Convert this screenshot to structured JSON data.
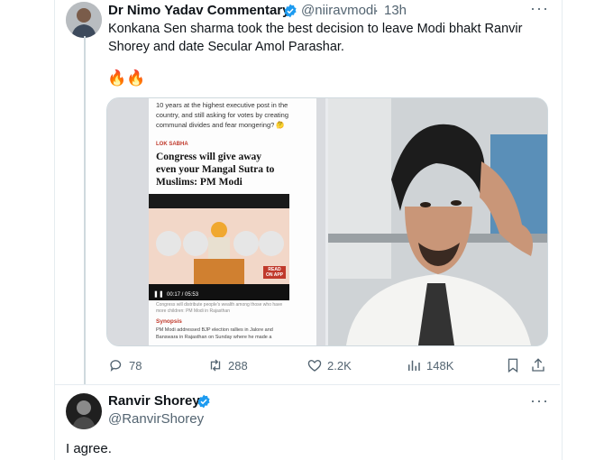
{
  "tweet": {
    "author_name": "Dr Nimo Yadav Commentary",
    "handle": "@niiravmodi",
    "separator": "·",
    "time": "13h",
    "text_line1": "Konkana Sen sharma took the best decision to leave Modi bhakt Ranvir",
    "text_line2": "Shorey and date Secular Amol Parashar.",
    "emoji": "🔥🔥",
    "media_left": {
      "top_text_1": "10 years at the highest executive post in the",
      "top_text_2": "country, and still asking for votes by creating",
      "top_text_3": "communal divides and fear mongering? 🤔",
      "section": "LOK SABHA",
      "headline_1": "Congress will give away",
      "headline_2": "even your Mangal Sutra to",
      "headline_3": "Muslims: PM Modi",
      "video_time": "00:17 / 05:53",
      "badge_1": "READ",
      "badge_2": "ON APP",
      "caption": "Congress will distribute people's wealth among those who have more children: PM Modi in Rajasthan",
      "synopsis_label": "Synopsis",
      "synopsis_1": "PM Modi addressed BJP election rallies in Jalore and",
      "synopsis_2": "Banswara in Rajasthan on Sunday where he made a"
    },
    "actions": {
      "replies": "78",
      "retweets": "288",
      "likes": "2.2K",
      "views": "148K"
    }
  },
  "reply": {
    "author_name": "Ranvir Shorey",
    "handle": "@RanvirShorey",
    "text": "I agree."
  },
  "colors": {
    "verified": "#1d9bf0",
    "secondary_text": "#536471",
    "thread_line": "#cfd9de"
  }
}
